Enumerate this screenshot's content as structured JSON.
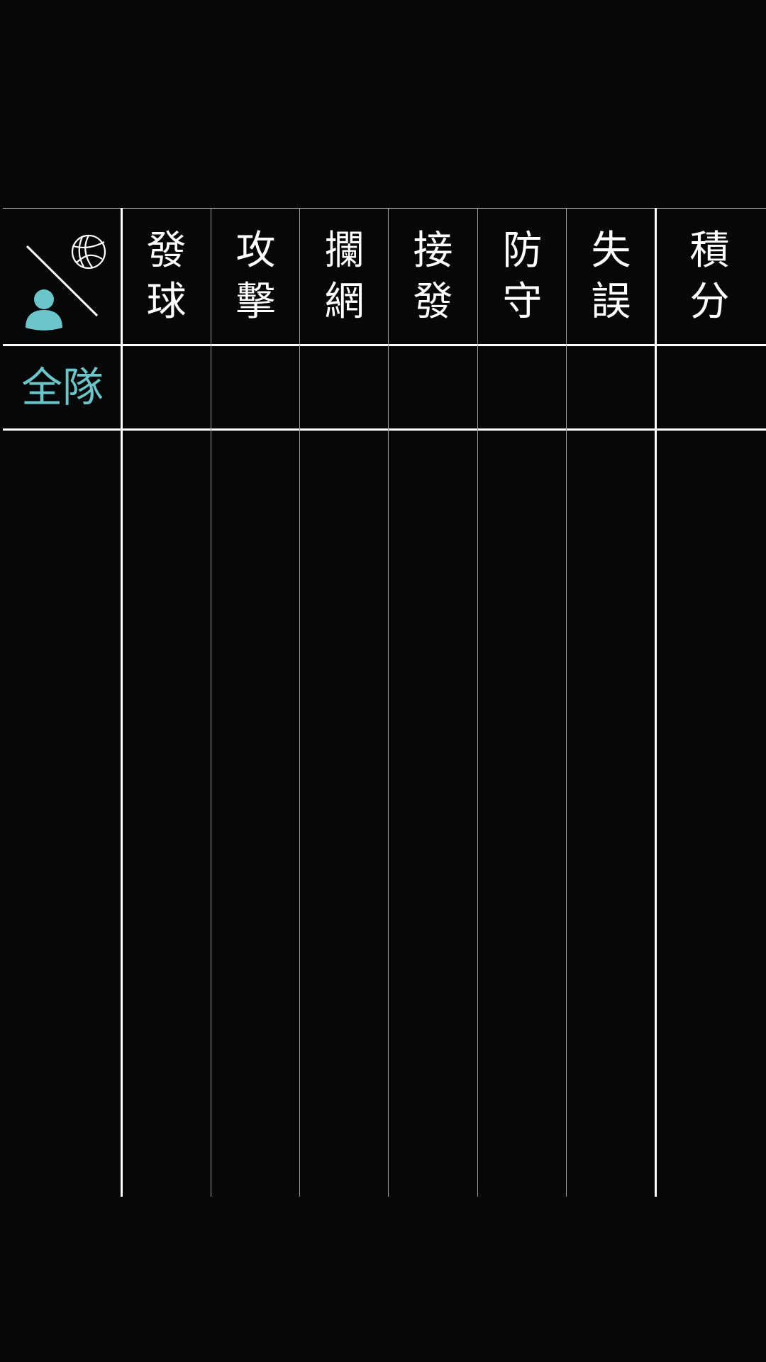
{
  "header": {
    "columns": [
      {
        "line1": "發",
        "line2": "球"
      },
      {
        "line1": "攻",
        "line2": "擊"
      },
      {
        "line1": "攔",
        "line2": "網"
      },
      {
        "line1": "接",
        "line2": "發"
      },
      {
        "line1": "防",
        "line2": "守"
      },
      {
        "line1": "失",
        "line2": "誤"
      },
      {
        "line1": "積",
        "line2": "分"
      }
    ],
    "corner_icons": [
      "volleyball-icon",
      "player-icon"
    ]
  },
  "team_row": {
    "label": "全隊"
  },
  "colors": {
    "background": "#060709",
    "grid": "#ffffff",
    "accent": "#6cc5c9"
  }
}
